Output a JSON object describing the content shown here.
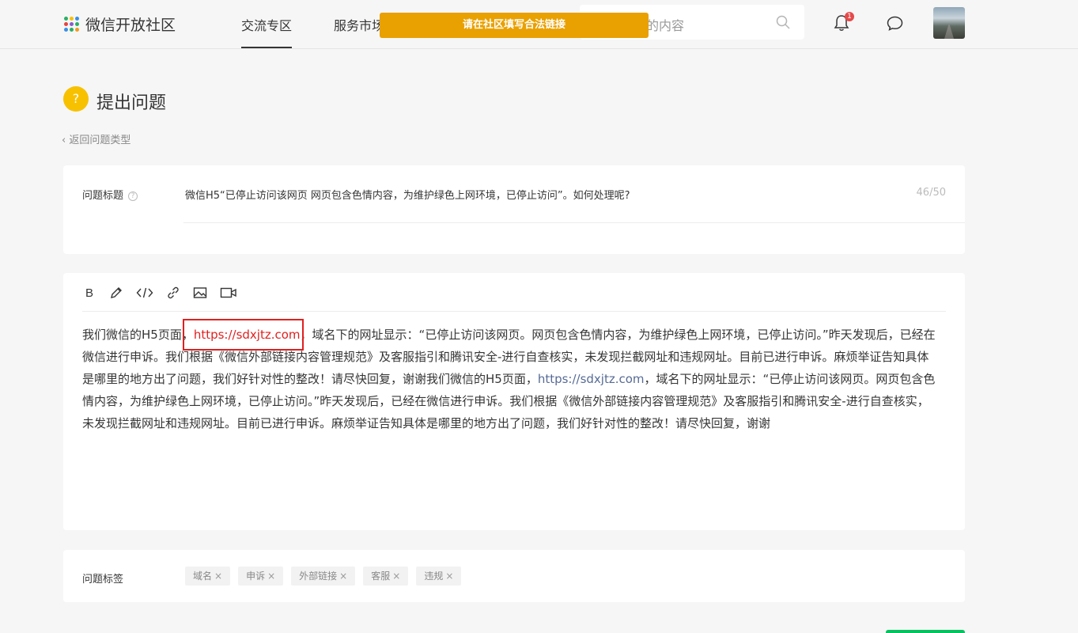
{
  "header": {
    "brand": "微信开放社区",
    "nav": [
      "交流专区",
      "服务市场"
    ],
    "search_placeholder": "的内容",
    "notification_count": "1"
  },
  "toast": "请在社区填写合法链接",
  "page": {
    "title": "提出问题",
    "title_icon": "?",
    "back_link": "返回问题类型"
  },
  "question_title": {
    "label": "问题标题",
    "value": "微信H5“已停止访问该网页 网页包含色情内容，为维护绿色上网环境，已停止访问”。如何处理呢?",
    "counter": "46/50"
  },
  "editor": {
    "toolbar": {
      "bold": "B",
      "icons": [
        "pencil-icon",
        "code-icon",
        "link-icon",
        "image-icon",
        "video-icon"
      ]
    },
    "segments": {
      "s1": "我们微信的H5页面，",
      "url1": "https://sdxjtz.com",
      "s2": "，域名下的网址显示：“已停止访问该网页。网页包含色情内容，为维护绿色上网环境，已停止访问。”昨天发现后，已经在微信进行申诉。我们根据《微信外部链接内容管理规范》及客服指引和腾讯安全-进行自查核实，未发现拦截网址和违规网址。目前已进行申诉。麻烦举证告知具体是哪里的地方出了问题，我们好针对性的整改！请尽快回复，谢谢我们微信的H5页面，",
      "url2": "https://sdxjtz.com",
      "s3": "，域名下的网址显示：“已停止访问该网页。网页包含色情内容，为维护绿色上网环境，已停止访问。”昨天发现后，已经在微信进行申诉。我们根据《微信外部链接内容管理规范》及客服指引和腾讯安全-进行自查核实，未发现拦截网址和违规网址。目前已进行申诉。麻烦举证告知具体是哪里的地方出了问题，我们好针对性的整改！请尽快回复，谢谢"
    }
  },
  "tags": {
    "label": "问题标签",
    "items": [
      "域名",
      "申诉",
      "外部链接",
      "客服",
      "违规"
    ],
    "remove_glyph": "×"
  },
  "colors": {
    "toast_bg": "#e9a001",
    "link_red": "#e02020",
    "link_blue": "#576b95",
    "accent_yellow": "#f7c100",
    "badge_red": "#e54a4a"
  }
}
